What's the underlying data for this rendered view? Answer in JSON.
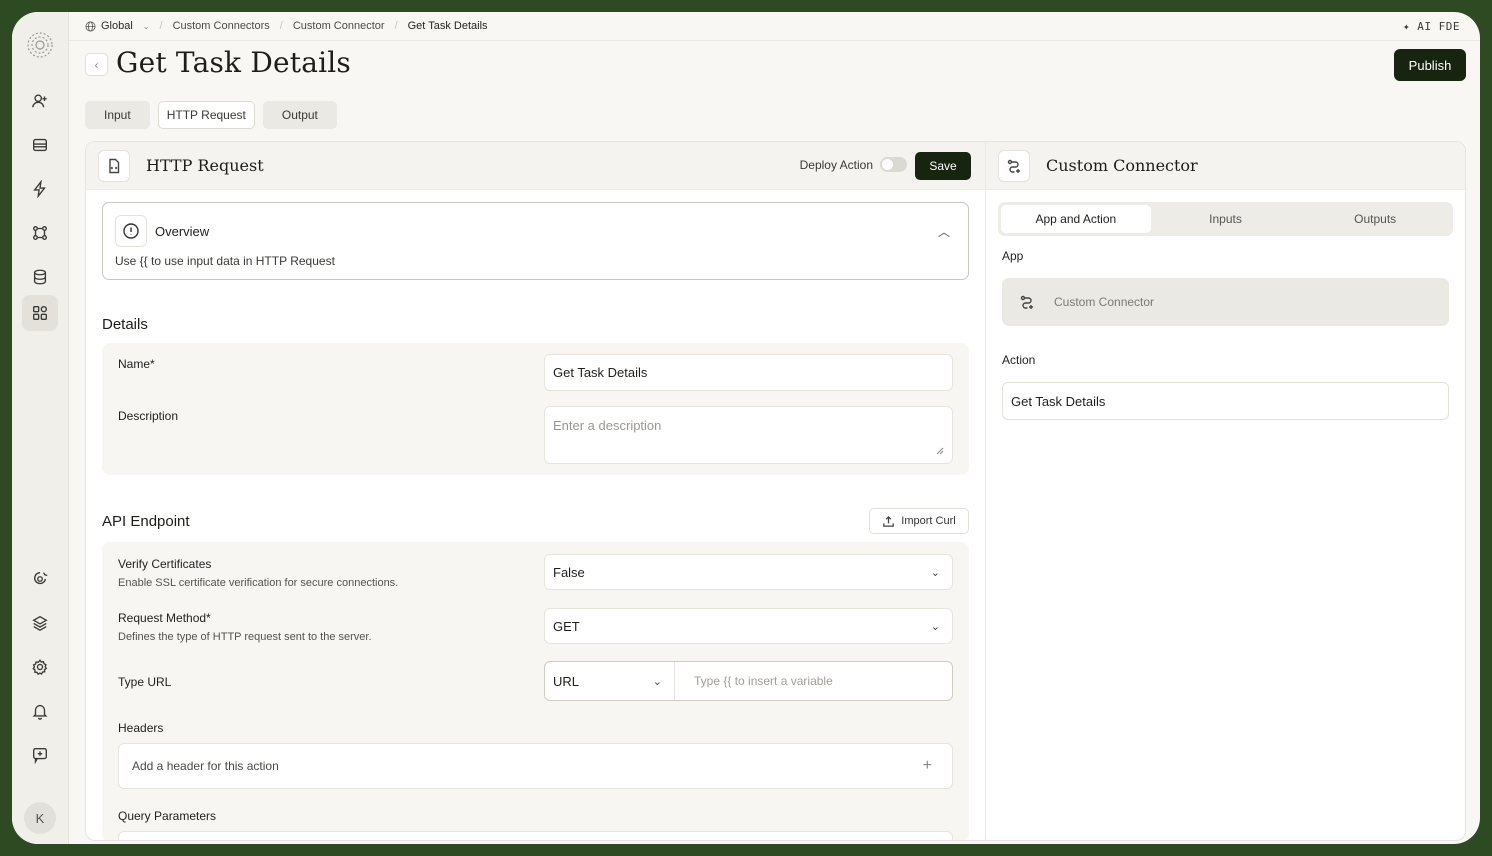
{
  "breadcrumb": {
    "items": [
      "Global",
      "Custom Connectors",
      "Custom Connector",
      "Get Task Details"
    ],
    "separator": "/"
  },
  "top_right": "✦ AI FDE",
  "header": {
    "back_glyph": "‹",
    "title": "Get Task Details",
    "publish_label": "Publish"
  },
  "tabs": [
    {
      "label": "Input",
      "active": false
    },
    {
      "label": "HTTP Request",
      "active": true
    },
    {
      "label": "Output",
      "active": false
    }
  ],
  "left_panel": {
    "title": "HTTP Request",
    "deploy_label": "Deploy Action",
    "deploy_enabled": false,
    "save_label": "Save",
    "overview": {
      "title": "Overview",
      "text": "Use {{ to use input data in HTTP Request"
    },
    "details": {
      "title": "Details",
      "name_label": "Name*",
      "name_value": "Get Task Details",
      "description_label": "Description",
      "description_placeholder": "Enter a description"
    },
    "api_endpoint": {
      "title": "API Endpoint",
      "import_label": "Import Curl",
      "verify_label": "Verify Certificates",
      "verify_sub": "Enable SSL certificate verification for secure connections.",
      "verify_value": "False",
      "method_label": "Request Method*",
      "method_sub": "Defines the type of HTTP request sent to the server.",
      "method_value": "GET",
      "url_label": "Type URL",
      "url_type": "URL",
      "url_placeholder": "Type {{ to insert a variable",
      "headers_label": "Headers",
      "headers_placeholder": "Add a header for this action",
      "query_label": "Query Parameters"
    }
  },
  "right_panel": {
    "title": "Custom Connector",
    "tabs": [
      {
        "label": "App and Action",
        "active": true
      },
      {
        "label": "Inputs",
        "active": false
      },
      {
        "label": "Outputs",
        "active": false
      }
    ],
    "app_label": "App",
    "app_value": "Custom Connector",
    "action_label": "Action",
    "action_value": "Get Task Details"
  },
  "sidebar": {
    "avatar_initial": "K",
    "icons": [
      "user-plus-icon",
      "inbox-icon",
      "lightning-icon",
      "workflow-icon",
      "database-icon",
      "apps-icon",
      "brain-icon",
      "layers-icon",
      "settings-icon",
      "bell-icon",
      "feedback-icon"
    ]
  },
  "colors": {
    "accent": "#17240f",
    "frame": "#2d4a22",
    "background": "#f8f7f3"
  }
}
